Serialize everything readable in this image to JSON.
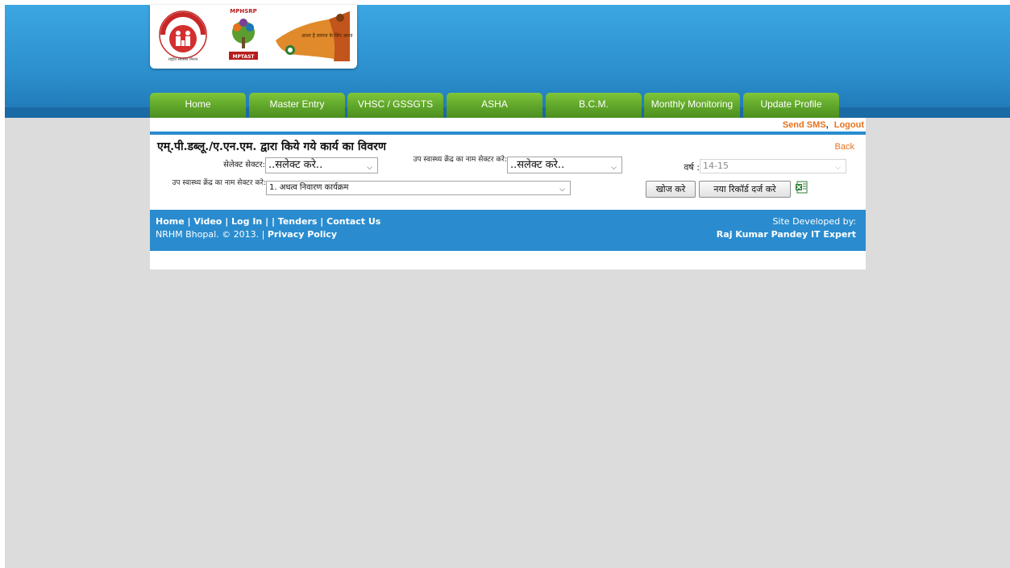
{
  "header": {
    "logos": {
      "nhm_text": "NATIONAL HEALTH MISSION",
      "nhm_sub": "राष्ट्रीय स्वास्थ्य मिशन",
      "mp_top": "MPHSRP",
      "mp_bottom": "MPTAST",
      "asha_text": "आशा है समाज के लिए आशा"
    }
  },
  "nav": {
    "tabs": [
      {
        "label": "Home"
      },
      {
        "label": "Master Entry"
      },
      {
        "label": "VHSC / GSSGTS"
      },
      {
        "label": "ASHA"
      },
      {
        "label": "B.C.M."
      },
      {
        "label": "Monthly Monitoring"
      },
      {
        "label": "Update Profile"
      }
    ]
  },
  "user_links": {
    "send_sms": "Send SMS",
    "separator": ",",
    "logout": "Logout"
  },
  "page": {
    "title": "एम्.पी.डब्लू./ए.एन.एम. द्वारा किये गये कार्य का विवरण",
    "back": "Back"
  },
  "form": {
    "sector_label": "सेलेक्ट सेक्टर:",
    "sector_value": "..सलेक्ट करे..",
    "subcenter_label": "उप स्वास्थ्य क्रेंद्र का नाम सेक्टर करे:",
    "subcenter_value": "..सलेक्ट करे..",
    "year_label": "वर्ष :",
    "year_value": "14-15",
    "program_label": "उप स्वास्थ्य क्रेंद्र का नाम सेक्टर करे:",
    "program_value": "1.  अधत्व निवारण कार्यक्रम",
    "search_button": "खोज करे",
    "new_record_button": "नया रिकॉर्ड दर्ज करे"
  },
  "footer": {
    "links": [
      "Home",
      "Video",
      "Log In",
      "",
      "Tenders",
      "Contact Us"
    ],
    "separator": " | ",
    "copyright": "NRHM Bhopal. © 2013. | ",
    "privacy": "Privacy Policy",
    "dev_label": "Site Developed by:",
    "dev_name": "Raj Kumar Pandey IT Expert"
  },
  "colors": {
    "header_blue": "#2c8fcd",
    "nav_green": "#5fa52a",
    "link_orange": "#e8721c",
    "footer_blue": "#2a8ccf",
    "background": "#dcdcdc"
  }
}
